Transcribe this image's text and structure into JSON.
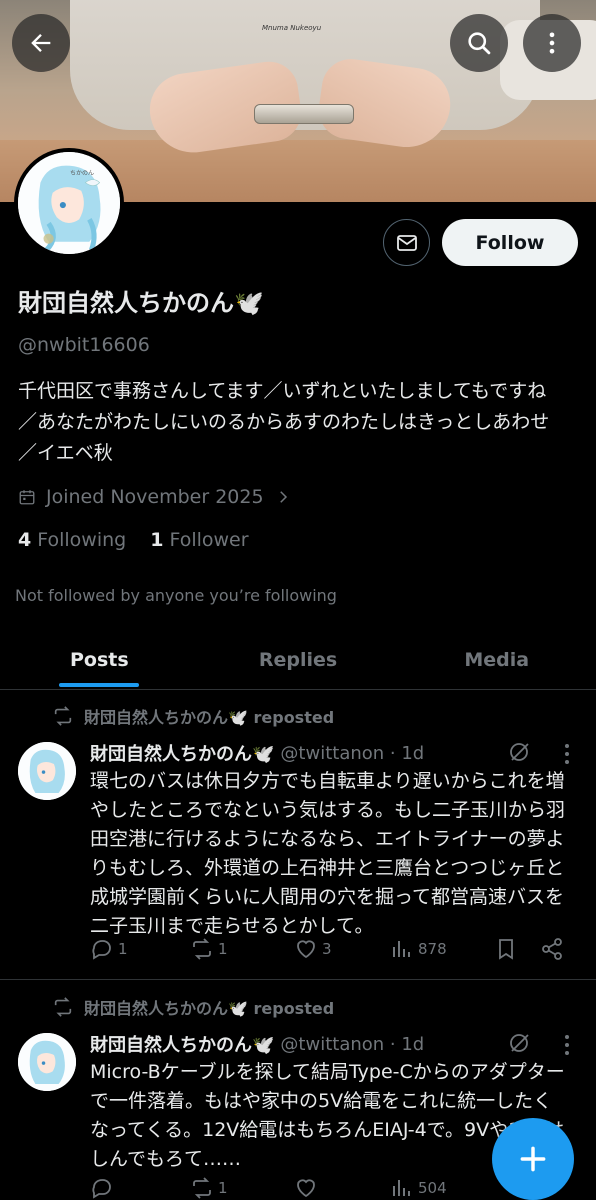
{
  "header": {
    "back_icon": "arrow-left-icon",
    "search_icon": "search-icon",
    "more_icon": "more-vertical-icon",
    "banner_shirt_text": "Mnuma Nukeoyu"
  },
  "profile": {
    "display_name": "財団自然人ちかのん",
    "display_emoji": "🕊️",
    "handle": "@nwbit16606",
    "bio_lines": [
      "千代田区で事務さんしてます／いずれといたしましてもですね",
      "／あなたがわたしにいのるからあすのわたしはきっとしあわせ",
      "／イエベ秋"
    ],
    "joined": "Joined November 2025",
    "following_count": "4",
    "following_label": "Following",
    "follower_count": "1",
    "follower_label": "Follower",
    "not_followed": "Not followed by anyone you’re following",
    "follow_button": "Follow",
    "avatar_caption": "ちかのん"
  },
  "tabs": [
    {
      "label": "Posts",
      "active": true
    },
    {
      "label": "Replies",
      "active": false
    },
    {
      "label": "Media",
      "active": false
    }
  ],
  "posts": [
    {
      "repost_label": "財団自然人ちかのん🕊️ reposted",
      "name": "財団自然人ちかのん🕊️",
      "handle_time": "@twittanon · 1d",
      "body_lines": [
        "環七のバスは休日夕方でも自転車より遅いからこれを増",
        "やしたところでなという気はする。もし二子玉川から羽",
        "田空港に行けるようになるなら、エイトライナーの夢よ",
        "りもむしろ、外環道の上石神井と三鷹台とつつじヶ丘と",
        "成城学園前くらいに人間用の穴を掘って都営高速バスを",
        "二子玉川まで走らせるとかして。"
      ],
      "replies": "1",
      "reposts": "1",
      "likes": "3",
      "views": "878"
    },
    {
      "repost_label": "財団自然人ちかのん🕊️ reposted",
      "name": "財団自然人ちかのん🕊️",
      "handle_time": "@twittanon · 1d",
      "body_lines": [
        "Micro-Bケーブルを探して結局Type-Cからのアダプター",
        "で一件落着。もはや家中の5V給電をこれに統一したく",
        "なってくる。12V給電はもちろんEIAJ-4で。9Vや12Vは",
        "しんでもろて……"
      ],
      "replies": "",
      "reposts": "1",
      "likes": "",
      "views": "504"
    }
  ],
  "fab": {
    "icon": "plus-icon"
  },
  "colors": {
    "accent": "#1d9bf0",
    "muted": "#71767b",
    "text": "#e7e9ea",
    "divider": "#2f3336"
  }
}
